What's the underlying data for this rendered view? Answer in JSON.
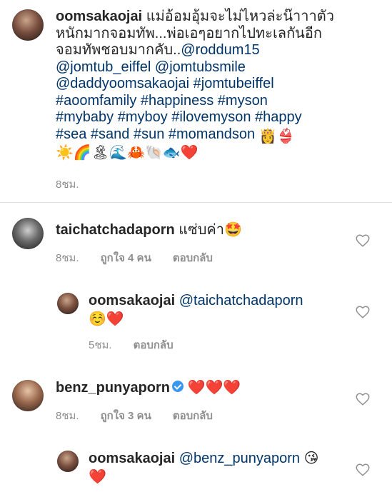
{
  "caption": {
    "username": "oomsakaojai",
    "text_line1": "แม่อ้อมอุ้มจะไม่ไหวล่ะน๊าาาตัว",
    "text_line2": "หนักมากจอมทัพ...พ่อเอๆอยากไปทะเลกันอีก",
    "text_line3": "จอมทัพชอบมากคับ..",
    "mention1": "@roddum15",
    "line4": "@jomtub_eiffel @jomtubsmile",
    "line5": "@daddyoomsakaojai #jomtubeiffel",
    "line6": "#aoomfamily #happiness #myson",
    "line7": "#mybaby #myboy #ilovemyson #happy",
    "line8": "#sea #sand #sun #momandson",
    "emoji_tail1": "👸👙",
    "emoji_line": "☀️🌈🏝🌊🦀🐚🐟❤️",
    "time": "8ชม."
  },
  "comments": [
    {
      "username": "taichatchadaporn",
      "text": "แซ่บค่า🤩",
      "time": "8ชม.",
      "likes": "ถูกใจ 4 คน",
      "reply": "ตอบกลับ"
    },
    {
      "username": "oomsakaojai",
      "mention": "@taichatchadaporn",
      "text": "☺️❤️",
      "time": "5ชม.",
      "reply": "ตอบกลับ"
    },
    {
      "username": "benz_punyaporn",
      "text": "❤️❤️❤️",
      "time": "8ชม.",
      "likes": "ถูกใจ 3 คน",
      "reply": "ตอบกลับ"
    },
    {
      "username": "oomsakaojai",
      "mention": "@benz_punyaporn",
      "text_tail": "😘",
      "text_line2": "❤️"
    }
  ]
}
